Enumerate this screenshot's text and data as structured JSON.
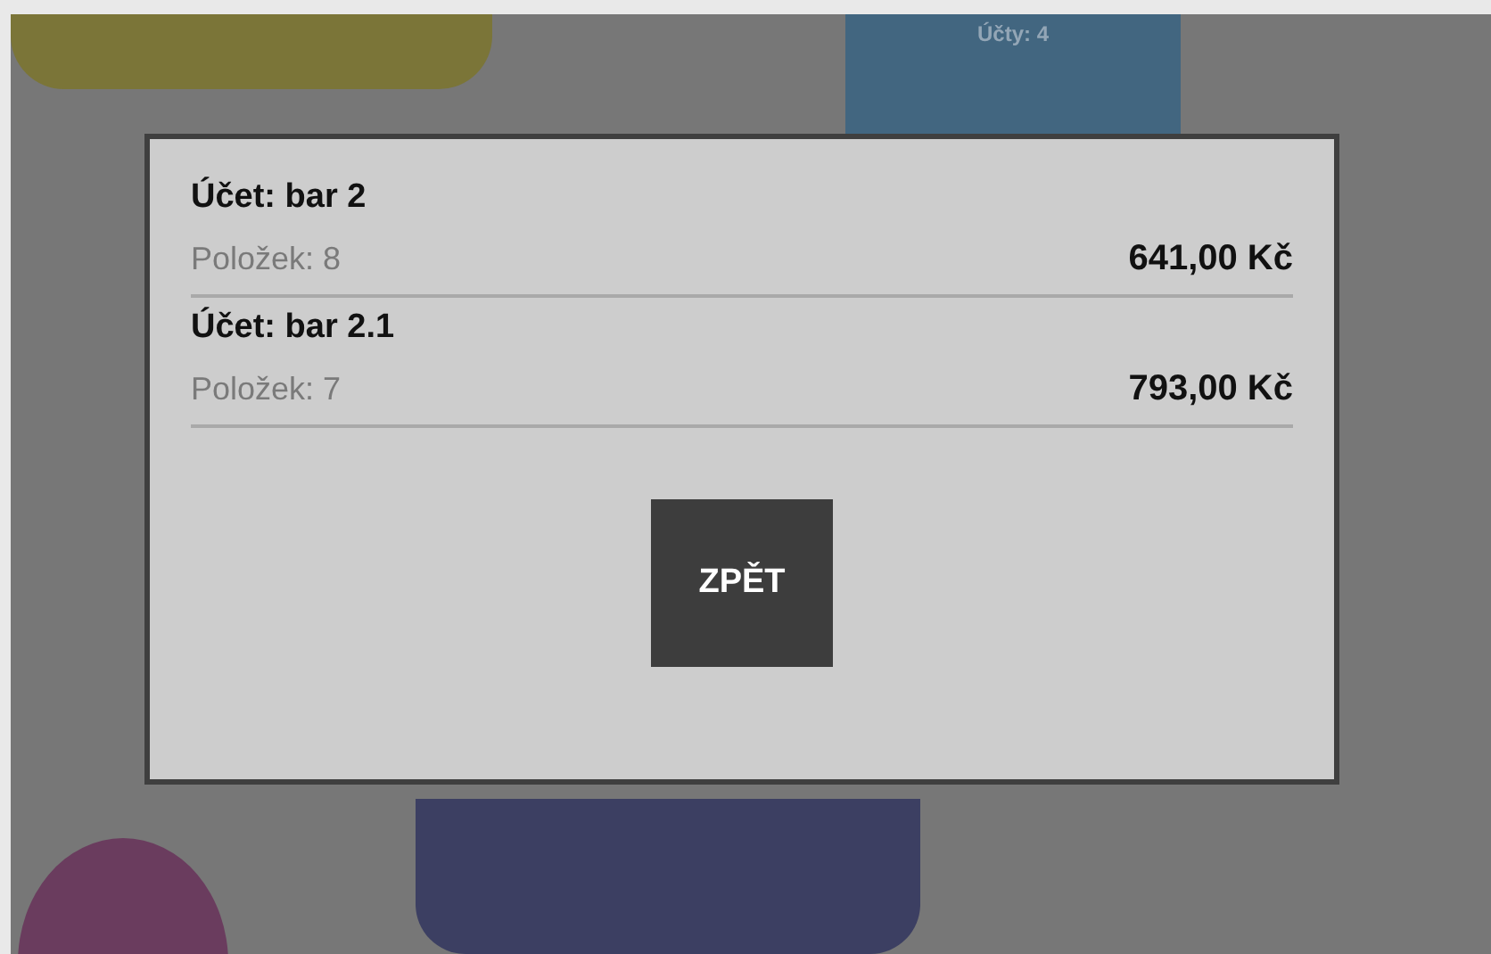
{
  "background_tiles": [
    {
      "kind": "rounded",
      "color": "#7b7538"
    },
    {
      "kind": "labeled",
      "color": "#426680",
      "label": "Účty: 4"
    },
    {
      "kind": "oval",
      "color": "#6a3c5e"
    },
    {
      "kind": "rounded",
      "color": "#3c3f62"
    }
  ],
  "dialog": {
    "accounts": [
      {
        "title": "Účet: bar 2",
        "items": "Položek: 8",
        "amount": "641,00 Kč"
      },
      {
        "title": "Účet: bar 2.1",
        "items": "Položek: 7",
        "amount": "793,00 Kč"
      }
    ],
    "button": "ZPĚT"
  }
}
